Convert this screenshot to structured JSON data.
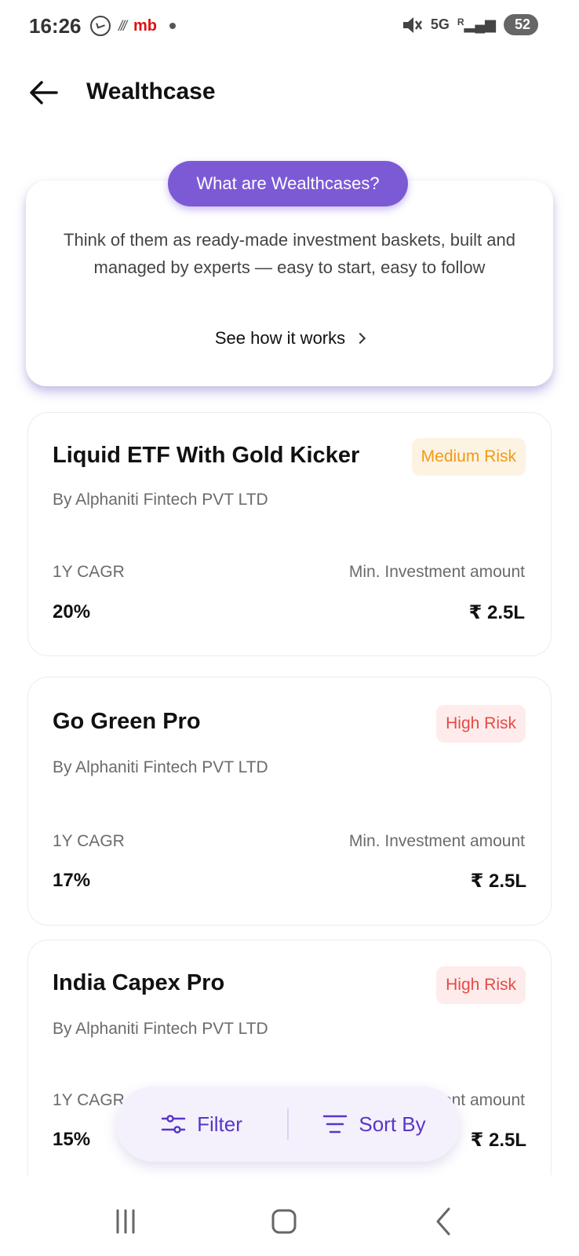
{
  "status_bar": {
    "time": "16:26",
    "carrier_text": "mb",
    "battery": "52",
    "network": "5G",
    "signal_label": "R"
  },
  "header": {
    "title": "Wealthcase"
  },
  "info": {
    "pill_label": "What are Wealthcases?",
    "description": "Think of them as ready-made investment baskets, built and managed by experts — easy to start, easy to follow",
    "link_label": "See how it works"
  },
  "funds": [
    {
      "name": "Liquid ETF With Gold Kicker",
      "risk": "Medium Risk",
      "by": "By Alphaniti Fintech PVT LTD",
      "cagr_label": "1Y CAGR",
      "cagr_value": "20%",
      "min_label": "Min. Investment amount",
      "min_value": "₹ 2.5L"
    },
    {
      "name": "Go Green Pro",
      "risk": "High Risk",
      "by": "By Alphaniti Fintech PVT LTD",
      "cagr_label": "1Y CAGR",
      "cagr_value": "17%",
      "min_label": "Min. Investment amount",
      "min_value": "₹ 2.5L"
    },
    {
      "name": "India Capex Pro",
      "risk": "High Risk",
      "by": "By Alphaniti Fintech PVT LTD",
      "cagr_label": "1Y CAGR",
      "cagr_value": "15%",
      "min_label": "Min. Investment amount",
      "min_value": "₹ 2.5L"
    }
  ],
  "filter_bar": {
    "filter_label": "Filter",
    "sort_label": "Sort By"
  },
  "colors": {
    "accent": "#7c5ad6",
    "medium_risk": "#f29a13",
    "high_risk": "#e64a48"
  }
}
